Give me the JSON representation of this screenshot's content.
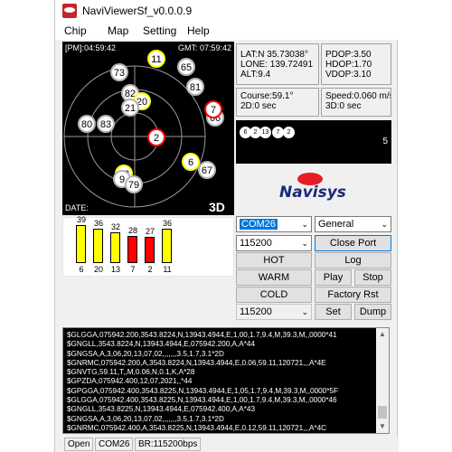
{
  "window": {
    "title": "NaviViewerSf_v0.0.0.9"
  },
  "menu": [
    "Chip",
    "Map",
    "Setting",
    "Help"
  ],
  "skyplot": {
    "pm_time": "[PM]:04:59:42",
    "gmt_time": "GMT: 07:59:42",
    "date_label": "DATE:",
    "fix_mode": "3D",
    "satellites": [
      {
        "prn": "11",
        "ring": "yellow"
      },
      {
        "prn": "73",
        "ring": "gray"
      },
      {
        "prn": "65",
        "ring": "gray"
      },
      {
        "prn": "81",
        "ring": "gray"
      },
      {
        "prn": "82",
        "ring": "gray"
      },
      {
        "prn": "20",
        "ring": "yellow"
      },
      {
        "prn": "21",
        "ring": "gray"
      },
      {
        "prn": "66",
        "ring": "gray"
      },
      {
        "prn": "83",
        "ring": "gray"
      },
      {
        "prn": "80",
        "ring": "gray"
      },
      {
        "prn": "2",
        "ring": "red"
      },
      {
        "prn": "13",
        "ring": "yellow"
      },
      {
        "prn": "9",
        "ring": "gray"
      },
      {
        "prn": "79",
        "ring": "gray"
      },
      {
        "prn": "6",
        "ring": "yellow"
      },
      {
        "prn": "67",
        "ring": "gray"
      },
      {
        "prn": "7",
        "ring": "red"
      }
    ]
  },
  "position": {
    "lat": "LAT:N 35.73038°",
    "lon": "LONE: 139.72491",
    "alt": "ALT:9.4"
  },
  "dop": {
    "pdop": "PDOP:3.50",
    "hdop": "HDOP:1.70",
    "vdop": "VDOP:3.10"
  },
  "course": {
    "course": "Course:59.1°",
    "d2": "2D:0 sec"
  },
  "speed": {
    "speed": "Speed:0.060 m/se",
    "d3": "3D:0 sec"
  },
  "sat_used": {
    "prns": [
      "6",
      "2",
      "13",
      "7",
      "2"
    ],
    "count": "5"
  },
  "logo": {
    "text": "Navisys"
  },
  "snr_chart": {
    "bars": [
      {
        "prn": "6",
        "snr": 39,
        "color": "#ffff00"
      },
      {
        "prn": "20",
        "snr": 36,
        "color": "#ffff00"
      },
      {
        "prn": "13",
        "snr": 32,
        "color": "#ffff00"
      },
      {
        "prn": "7",
        "snr": 28,
        "color": "#ff0000"
      },
      {
        "prn": "2",
        "snr": 27,
        "color": "#ff0000"
      },
      {
        "prn": "11",
        "snr": 36,
        "color": "#ffff00"
      }
    ],
    "max": 45
  },
  "controls": {
    "com_port": "COM26",
    "mode": "General",
    "baud1": "115200",
    "close_port": "Close Port",
    "hot": "HOT",
    "log": "Log",
    "warm": "WARM",
    "play": "Play",
    "stop": "Stop",
    "cold": "COLD",
    "factory_rst": "Factory Rst",
    "baud2": "115200",
    "set": "Set",
    "dump": "Dump"
  },
  "nmea_log": [
    "$GLGGA,075942.200,3543.8224,N,13943.4944,E,1,00,1.7,9.4,M,39.3,M,,0000*41",
    "$GNGLL,3543.8224,N,13943.4944,E,075942.200,A,A*44",
    "$GNGSA,A,3,06,20,13,07,02,,,,,,,3.5,1.7,3.1*2D",
    "$GNRMC,075942.200,A,3543.8224,N,13943.4944,E,0.06,59.11,120721,,,A*4E",
    "$GNVTG,59.11,T,,M,0.06,N,0.1,K,A*28",
    "$GPZDA,075942.400,12,07,2021,,*44",
    "$GPGGA,075942.400,3543.8225,N,13943.4944,E,1,05,1.7,9.4,M,39.3,M,,0000*5F",
    "$GLGGA,075942.400,3543.8225,N,13943.4944,E,1,00,1.7,9.4,M,39.3,M,,0000*46",
    "$GNGLL,3543.8225,N,13943.4944,E,075942.400,A,A*43",
    "$GNGSA,A,3,06,20,13,07,02,,,,,,,3.5,1.7,3.1*2D",
    "$GNRMC,075942.400,A,3543.8225,N,13943.4944,E,0.12,59.11,120721,,,A*4C"
  ],
  "status": {
    "state": "Open",
    "port": "COM26",
    "baud": "BR:115200bps"
  }
}
